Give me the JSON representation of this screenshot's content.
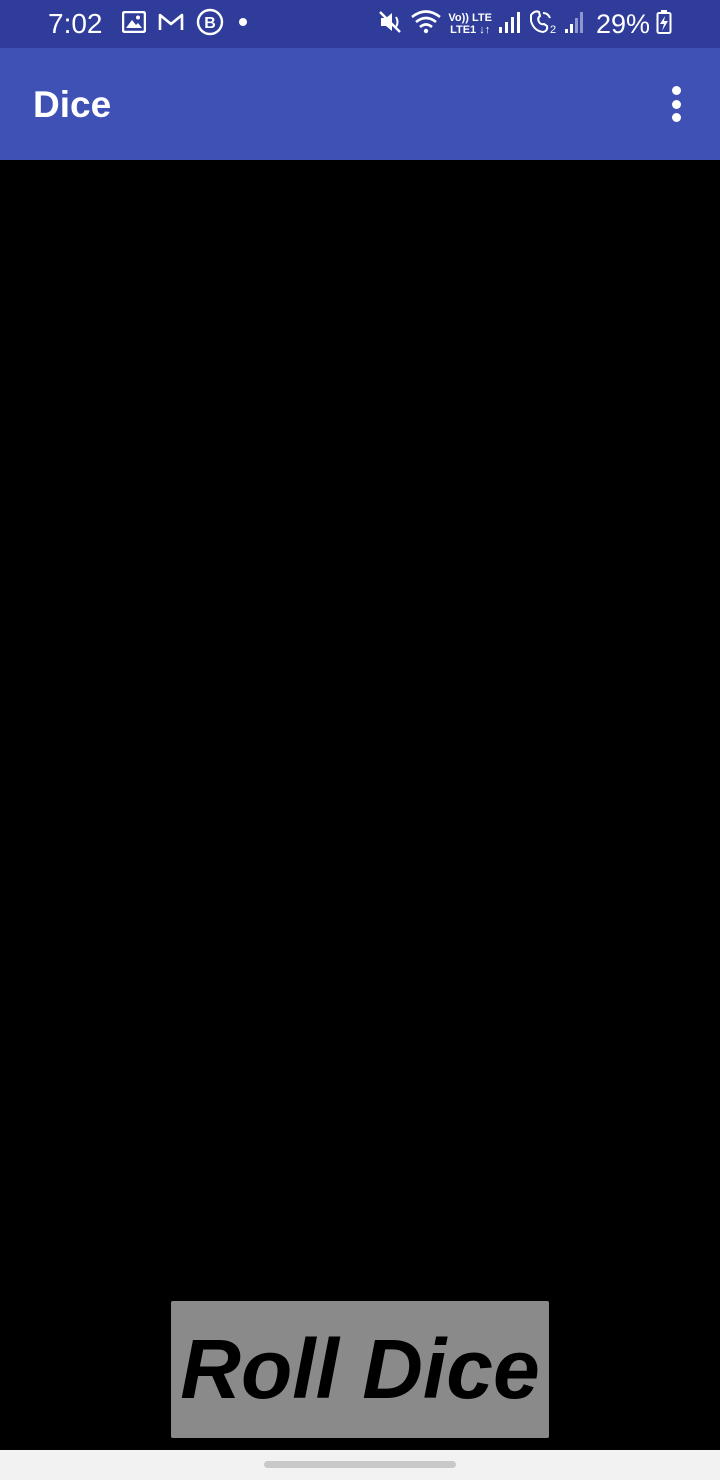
{
  "status_bar": {
    "time": "7:02",
    "left_icons": [
      "image-icon",
      "gmail-icon",
      "b-circle-icon",
      "dot-icon"
    ],
    "right_icons": [
      "mute-icon",
      "wifi-icon",
      "signal-icon",
      "wifi-calling-icon",
      "signal-icon",
      "battery-charging-icon"
    ],
    "lte_top": "Vo)) LTE",
    "lte_bottom": "LTE1 ↓↑",
    "battery": "29%",
    "background_color": "#2F3C9A"
  },
  "app_bar": {
    "title": "Dice",
    "menu_icon": "more-vert-icon",
    "background_color": "#3F51B5"
  },
  "main": {
    "roll_button_label": "Roll Dice",
    "button_color": "#8A8A8A",
    "background_color": "#000000"
  },
  "nav_bar": {
    "background_color": "#F2F2F2"
  }
}
